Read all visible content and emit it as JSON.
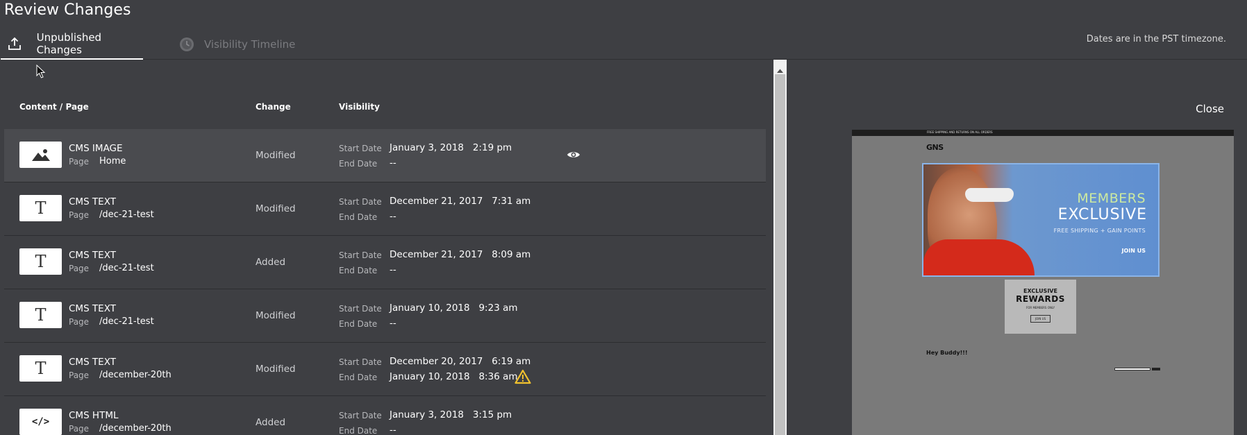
{
  "header": {
    "title": "Review Changes"
  },
  "tabs": [
    {
      "label": "Unpublished Changes",
      "icon": "upload-icon",
      "active": true
    },
    {
      "label": "Visibility Timeline",
      "icon": "clock-icon",
      "active": false
    }
  ],
  "timezone_note": "Dates are in the PST timezone.",
  "columns": {
    "content": "Content / Page",
    "change": "Change",
    "visibility": "Visibility"
  },
  "labels": {
    "page": "Page",
    "start": "Start Date",
    "end": "End Date"
  },
  "rows": [
    {
      "icon": "image-icon",
      "type": "CMS IMAGE",
      "page": "Home",
      "change": "Modified",
      "start": "January 3, 2018   2:19 pm",
      "end": "--",
      "selected": true,
      "preview_icon": "eye-icon"
    },
    {
      "icon": "text-icon",
      "type": "CMS TEXT",
      "page": "/dec-21-test",
      "change": "Modified",
      "start": "December 21, 2017   7:31 am",
      "end": "--"
    },
    {
      "icon": "text-icon",
      "type": "CMS TEXT",
      "page": "/dec-21-test",
      "change": "Added",
      "start": "December 21, 2017   8:09 am",
      "end": "--"
    },
    {
      "icon": "text-icon",
      "type": "CMS TEXT",
      "page": "/dec-21-test",
      "change": "Modified",
      "start": "January 10, 2018   9:23 am",
      "end": "--"
    },
    {
      "icon": "text-icon",
      "type": "CMS TEXT",
      "page": "/december-20th",
      "change": "Modified",
      "start": "December 20, 2017   6:19 am",
      "end": "January 10, 2018   8:36 am",
      "warning_icon": "warning-icon"
    },
    {
      "icon": "code-icon",
      "type": "CMS HTML",
      "page": "/december-20th",
      "change": "Added",
      "start": "January 3, 2018   3:15 pm",
      "end": "--"
    }
  ],
  "thumb_glyphs": {
    "text": "T",
    "code": "</>"
  },
  "preview": {
    "close_label": "Close",
    "site": {
      "topbar": "FREE SHIPPING AND RETURNS ON ALL ORDERS",
      "logo": "GNS",
      "hero_line1": "MEMBERS",
      "hero_line2": "EXCLUSIVE",
      "hero_line3": "FREE SHIPPING + GAIN POINTS",
      "hero_cta": "JOIN US",
      "rewards_line1": "EXCLUSIVE",
      "rewards_line2": "REWARDS",
      "rewards_line3": "FOR MEMBERS ONLY",
      "rewards_cta": "JOIN US",
      "greeting": "Hey Buddy!!!"
    }
  },
  "colors": {
    "background": "#3e3f43",
    "selected_row": "#4a4b4f",
    "warning": "#f2c22e",
    "text": "#ffffff"
  }
}
